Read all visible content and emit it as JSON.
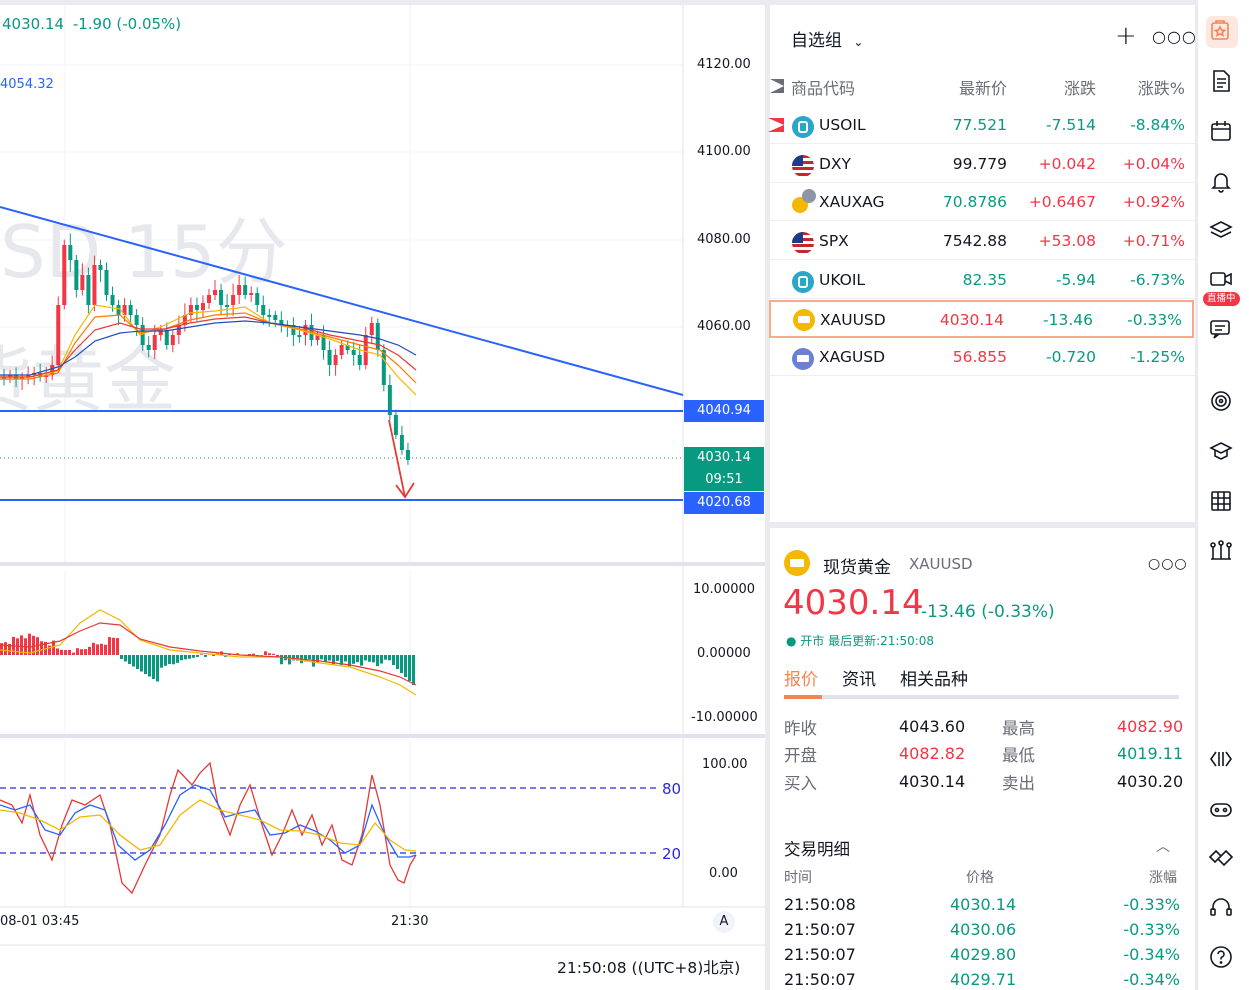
{
  "chart": {
    "header_price": "4030.14",
    "header_change": "-1.90 (-0.05%)",
    "indicator_value": "4054.32",
    "watermark_sym": "SD 15分",
    "watermark_name": "货黄金",
    "price_axis": [
      "4120.00",
      "4100.00",
      "4080.00",
      "4060.00"
    ],
    "level_upper": "4040.94",
    "level_lower": "4020.68",
    "last_price": "4030.14",
    "countdown": "09:51",
    "macd_axis": [
      "10.00000",
      "0.00000",
      "-10.00000"
    ],
    "stoch_axis": [
      "100.00",
      "0.00"
    ],
    "stoch_lines": [
      "80",
      "20"
    ],
    "time_labels": [
      "08-01 03:45",
      "21:30"
    ],
    "auto_label": "A",
    "clock": "21:50:08 ((UTC+8)北京)",
    "colors": {
      "up": "#f23645",
      "down": "#089981",
      "line_blue": "#2962ff",
      "arrow": "#e53935"
    }
  },
  "watchlist": {
    "title": "自选组",
    "columns": [
      "商品代码",
      "最新价",
      "涨跌",
      "涨跌%"
    ],
    "rows": [
      {
        "sym": "USOIL",
        "price": "77.521",
        "chg": "-7.514",
        "pct": "-8.84%",
        "dir": "dn",
        "icon": "oil-icon"
      },
      {
        "sym": "DXY",
        "price": "99.779",
        "chg": "+0.042",
        "pct": "+0.04%",
        "dir": "up",
        "icon": "us-flag-icon"
      },
      {
        "sym": "XAUXAG",
        "price": "70.8786",
        "chg": "+0.6467",
        "pct": "+0.92%",
        "dir": "up",
        "icon": "gold-silver-icon"
      },
      {
        "sym": "SPX",
        "price": "7542.88",
        "chg": "+53.08",
        "pct": "+0.71%",
        "dir": "up",
        "icon": "us-flag-icon"
      },
      {
        "sym": "UKOIL",
        "price": "82.35",
        "chg": "-5.94",
        "pct": "-6.73%",
        "dir": "dn",
        "icon": "oil-icon"
      },
      {
        "sym": "XAUUSD",
        "price": "4030.14",
        "chg": "-13.46",
        "pct": "-0.33%",
        "dir": "mixed",
        "icon": "gold-icon"
      },
      {
        "sym": "XAGUSD",
        "price": "56.855",
        "chg": "-0.720",
        "pct": "-1.25%",
        "dir": "mixed",
        "icon": "silver-icon"
      }
    ]
  },
  "details": {
    "name": "现货黄金",
    "symbol": "XAUUSD",
    "price": "4030.14",
    "change": "-13.46 (-0.33%)",
    "status": "● 开市 最后更新:21:50:08",
    "tabs": [
      "报价",
      "资讯",
      "相关品种"
    ],
    "stats": {
      "prev_close_label": "昨收",
      "prev_close": "4043.60",
      "high_label": "最高",
      "high": "4082.90",
      "open_label": "开盘",
      "open": "4082.82",
      "low_label": "最低",
      "low": "4019.11",
      "bid_label": "买入",
      "bid": "4030.14",
      "ask_label": "卖出",
      "ask": "4030.20"
    },
    "trades_title": "交易明细",
    "trades_cols": [
      "时间",
      "价格",
      "涨幅"
    ],
    "trades": [
      {
        "time": "21:50:08",
        "price": "4030.14",
        "pct": "-0.33%"
      },
      {
        "time": "21:50:07",
        "price": "4030.06",
        "pct": "-0.33%"
      },
      {
        "time": "21:50:07",
        "price": "4029.80",
        "pct": "-0.34%"
      },
      {
        "time": "21:50:07",
        "price": "4029.71",
        "pct": "-0.34%"
      }
    ]
  },
  "sidebar": {
    "live_badge": "直播中"
  }
}
